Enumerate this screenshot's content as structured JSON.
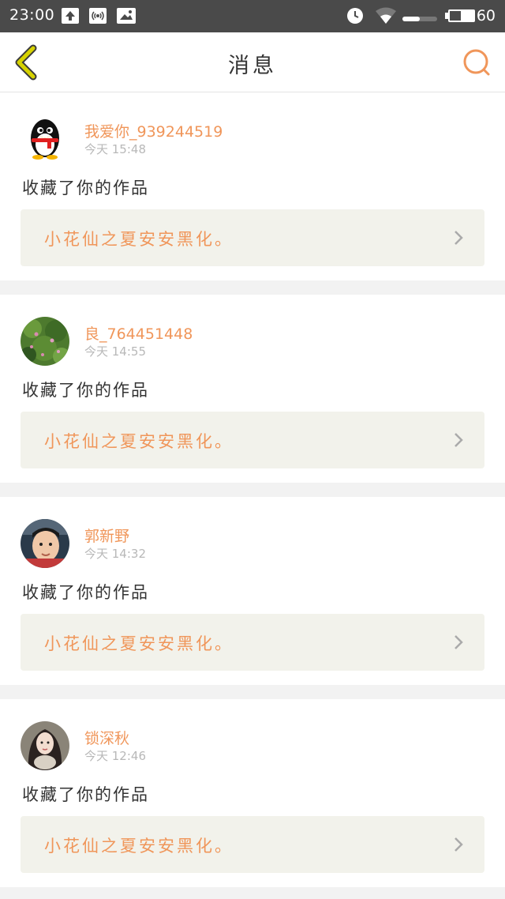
{
  "status_bar": {
    "time": "23:00",
    "battery": "60",
    "icons": [
      "upload-icon",
      "wifi-hotspot-icon",
      "image-icon",
      "alarm-clock-icon",
      "wifi-signal-icon",
      "signal-bars-icon",
      "battery-icon"
    ]
  },
  "header": {
    "title": "消息",
    "back_icon": "chevron-left-icon",
    "search_icon": "search-icon"
  },
  "colors": {
    "accent": "#f0965a",
    "back_icon": "#c8c800"
  },
  "messages": [
    {
      "username": "我爱你_939244519",
      "time": "今天 15:48",
      "action": "收藏了你的作品",
      "work_title": "小花仙之夏安安黑化。",
      "avatar": "qq-penguin-avatar"
    },
    {
      "username": "良_764451448",
      "time": "今天 14:55",
      "action": "收藏了你的作品",
      "work_title": "小花仙之夏安安黑化。",
      "avatar": "flower-bush-avatar"
    },
    {
      "username": "郭新野",
      "time": "今天 14:32",
      "action": "收藏了你的作品",
      "work_title": "小花仙之夏安安黑化。",
      "avatar": "child-photo-avatar"
    },
    {
      "username": "锁深秋",
      "time": "今天 12:46",
      "action": "收藏了你的作品",
      "work_title": "小花仙之夏安安黑化。",
      "avatar": "girl-photo-avatar"
    }
  ]
}
